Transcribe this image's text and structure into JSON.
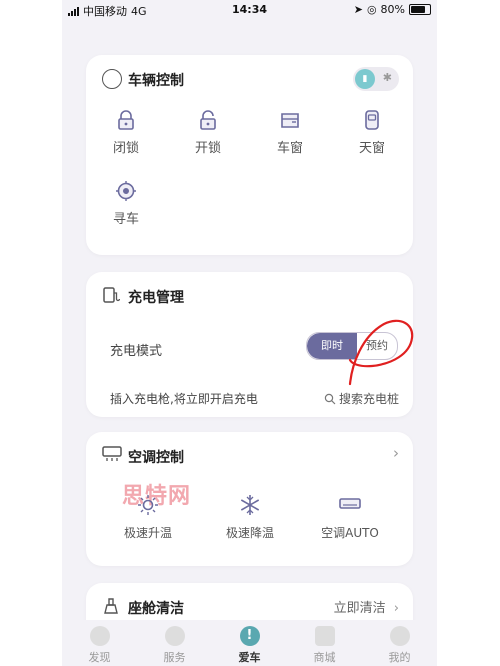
{
  "status_bar": {
    "carrier": "中国移动",
    "network": "4G",
    "time": "14:34",
    "battery": "80%"
  },
  "vehicle_control": {
    "title": "车辆控制",
    "controls": [
      {
        "label": "闭锁",
        "icon": "lock-closed-icon"
      },
      {
        "label": "开锁",
        "icon": "lock-open-icon"
      },
      {
        "label": "车窗",
        "icon": "car-window-icon"
      },
      {
        "label": "天窗",
        "icon": "sunroof-icon"
      },
      {
        "label": "寻车",
        "icon": "find-car-icon"
      }
    ],
    "toggle_icons": [
      "signal-icon",
      "bluetooth-icon"
    ]
  },
  "charging": {
    "title": "充电管理",
    "mode_label": "充电模式",
    "mode_options": [
      "即时",
      "预约"
    ],
    "selected_mode": "即时",
    "hint": "插入充电枪,将立即开启充电",
    "find_pile": "搜索充电桩"
  },
  "ac_control": {
    "title": "空调控制",
    "watermark": "思特网",
    "items": [
      {
        "label": "极速升温",
        "icon": "sun-heat-icon"
      },
      {
        "label": "极速降温",
        "icon": "snowflake-icon"
      },
      {
        "label": "空调AUTO",
        "icon": "air-conditioner-icon"
      }
    ]
  },
  "cabin_clean": {
    "title": "座舱清洁",
    "action": "立即清洁"
  },
  "tab_bar": {
    "tabs": [
      {
        "label": "发现",
        "icon": "compass-icon",
        "active": false
      },
      {
        "label": "服务",
        "icon": "heart-icon",
        "active": false
      },
      {
        "label": "爱车",
        "icon": "car-alert-icon",
        "active": true
      },
      {
        "label": "商城",
        "icon": "shop-icon",
        "active": false
      },
      {
        "label": "我的",
        "icon": "user-icon",
        "active": false
      }
    ]
  },
  "colors": {
    "accent": "#6b6b9e",
    "active_tab": "#5aa8b0",
    "annotation": "#e02020"
  }
}
